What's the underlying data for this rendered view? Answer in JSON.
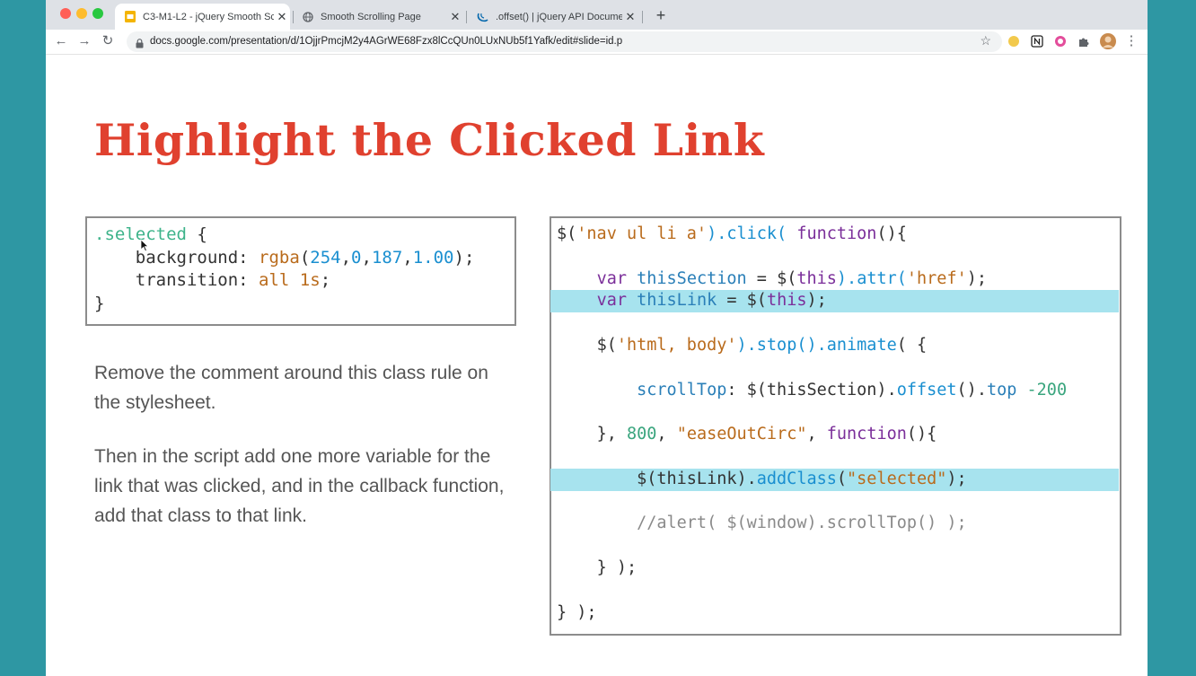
{
  "browser": {
    "tabs": [
      {
        "title": "C3-M1-L2 - jQuery Smooth Sc",
        "icon": "google-slides-icon",
        "active": true
      },
      {
        "title": "Smooth Scrolling Page",
        "icon": "globe-icon",
        "active": false
      },
      {
        "title": ".offset() | jQuery API Documen",
        "icon": "jquery-icon",
        "active": false
      }
    ],
    "close_glyph": "✕",
    "new_tab_glyph": "+",
    "url": "docs.google.com/presentation/d/1OjjrPmcjM2y4AGrWE68Fzx8lCcQUn0LUxNUb5f1Yafk/edit#slide=id.p",
    "nav": {
      "back": "←",
      "forward": "→",
      "reload": "↻"
    },
    "bookmark_glyph": "☆",
    "menu_glyph": "⋮"
  },
  "slide": {
    "title": "Highlight the Clicked Link",
    "paragraphs": [
      "Remove the comment around this class rule on the stylesheet.",
      "Then in the script add one more variable for the link that was clicked, and in the callback function, add that class to that link."
    ],
    "css_code": {
      "selector": ".selected",
      "open_brace": " {",
      "indent": "    ",
      "background_prop": "background",
      "background_func": "rgba",
      "background_args": [
        "254",
        "0",
        "187",
        "1.00"
      ],
      "transition_prop": "transition",
      "transition_value": "all 1s",
      "close_brace": "}"
    },
    "js_code": {
      "selector_call_prefix": "$(",
      "selector_string": "'nav ul li a'",
      "click_call": ").click( ",
      "function_kw": "function",
      "open_fn": "(){",
      "var_kw": "var",
      "this_section_name": "thisSection",
      "this_section_value_prefix": " = $(",
      "this_kw": "this",
      "attr_call": ").attr(",
      "href_string": "'href'",
      "line_end": ");",
      "this_link_name": "thisLink",
      "this_link_value_prefix": " = $(",
      "this_link_end": ");",
      "html_body_prefix": "$(",
      "html_body_string": "'html, body'",
      "stop_call": ").stop().",
      "animate_call": "animate",
      "animate_open": "( {",
      "scrolltop_key": "scrollTop",
      "scrolltop_mid": ": $(thisSection).",
      "offset_call": "offset",
      "offset_mid": "().",
      "top_key": "top",
      "minus_value": " -200",
      "close_obj": "}, ",
      "duration": "800",
      "comma": ", ",
      "easing_string": "\"easeOutCirc\"",
      "comma2": ", ",
      "function_kw2": "function",
      "open_fn2": "(){",
      "this_link_call_prefix": "$(thisLink).",
      "add_class_call": "addClass",
      "add_class_open": "(",
      "selected_string": "\"selected\"",
      "add_class_end": ");",
      "comment_line": "//alert( $(window).scrollTop() );",
      "inner_close": "} );",
      "outer_close": "} );"
    }
  }
}
